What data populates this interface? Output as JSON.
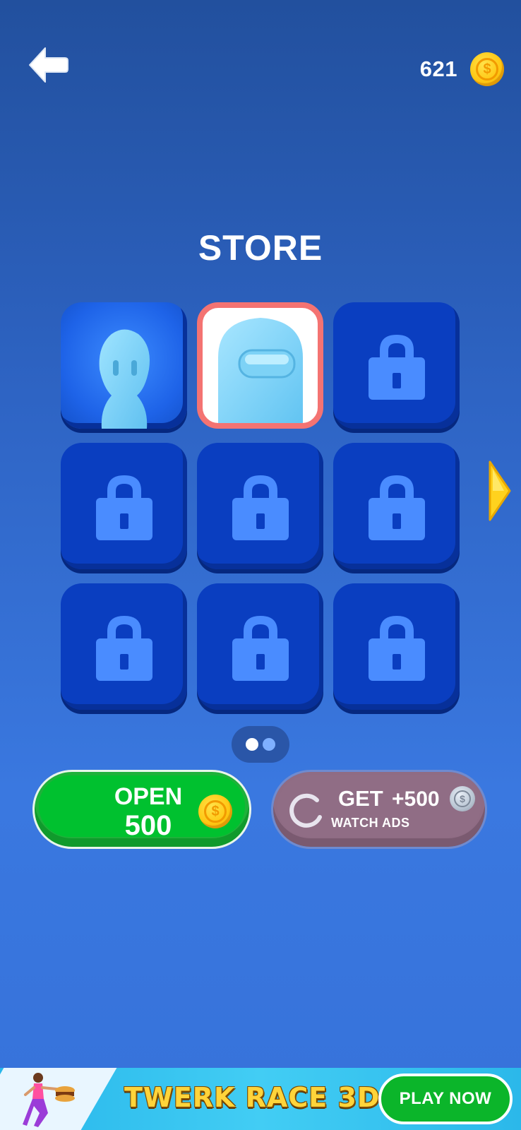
{
  "header": {
    "back_icon": "back-arrow-icon",
    "coin_count": "621",
    "coin_icon": "gold-coin-icon",
    "coin_symbol": "$"
  },
  "store": {
    "title": "STORE",
    "grid": [
      {
        "state": "owned",
        "character": "stickman"
      },
      {
        "state": "selected",
        "character": "crewmate"
      },
      {
        "state": "locked"
      },
      {
        "state": "locked"
      },
      {
        "state": "locked"
      },
      {
        "state": "locked"
      },
      {
        "state": "locked"
      },
      {
        "state": "locked"
      },
      {
        "state": "locked"
      }
    ],
    "next_page_icon": "chevron-right-icon",
    "pager": {
      "pages": 2,
      "current": 1
    }
  },
  "actions": {
    "open": {
      "label": "OPEN",
      "price": "500",
      "coin_symbol": "$"
    },
    "ads": {
      "get": "GET",
      "amount": "+500",
      "sub": "WATCH ADS",
      "coin_symbol": "$"
    }
  },
  "ad_banner": {
    "title": "TWERK RACE 3D",
    "cta": "PLAY NOW"
  },
  "colors": {
    "background": "#2e64c4",
    "slot": "#0a3ec0",
    "lock": "#4a8cff",
    "selected_border": "#f47372",
    "open_button": "#00c12f",
    "ads_button": "#906d85",
    "arrow": "#ffd21e"
  }
}
